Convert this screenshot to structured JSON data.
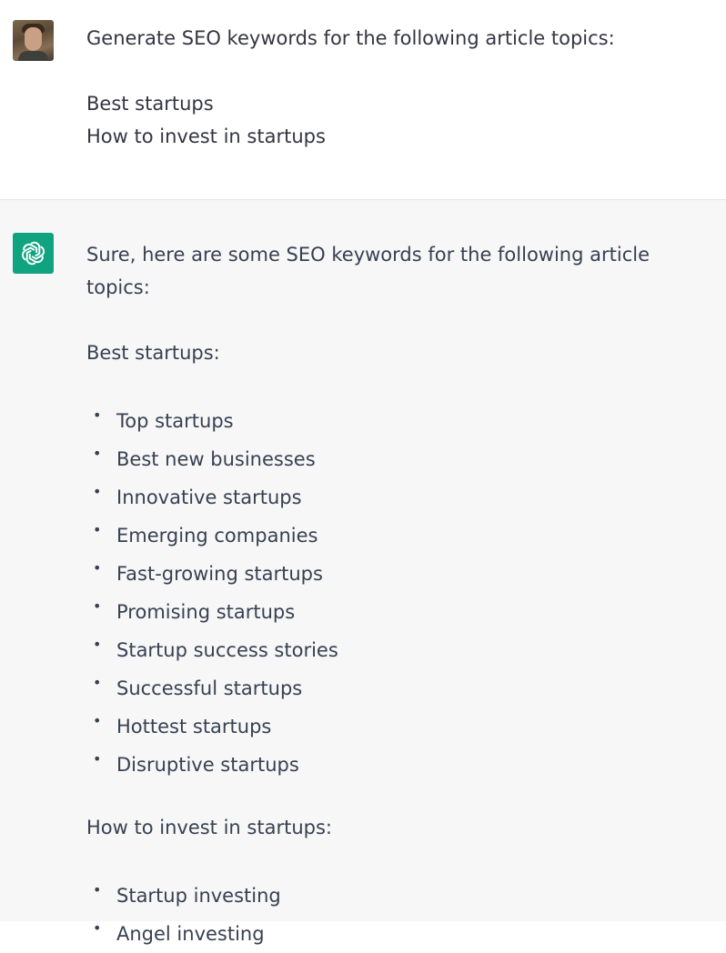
{
  "conversation": {
    "user_message": {
      "avatar": "user-avatar-photo",
      "lines": [
        "Generate SEO keywords for the following article topics:",
        "",
        "Best startups",
        "How to invest in startups"
      ]
    },
    "assistant_message": {
      "avatar": "openai-logo-icon",
      "intro": "Sure, here are some SEO keywords for the following article topics:",
      "sections": [
        {
          "heading": "Best startups:",
          "items": [
            "Top startups",
            "Best new businesses",
            "Innovative startups",
            "Emerging companies",
            "Fast-growing startups",
            "Promising startups",
            "Startup success stories",
            "Successful startups",
            "Hottest startups",
            "Disruptive startups"
          ]
        },
        {
          "heading": "How to invest in startups:",
          "items": [
            "Startup investing",
            "Angel investing"
          ]
        }
      ]
    }
  },
  "colors": {
    "assistant_avatar_bg": "#10a37f",
    "assistant_row_bg": "#f7f7f8",
    "text": "#374151"
  }
}
